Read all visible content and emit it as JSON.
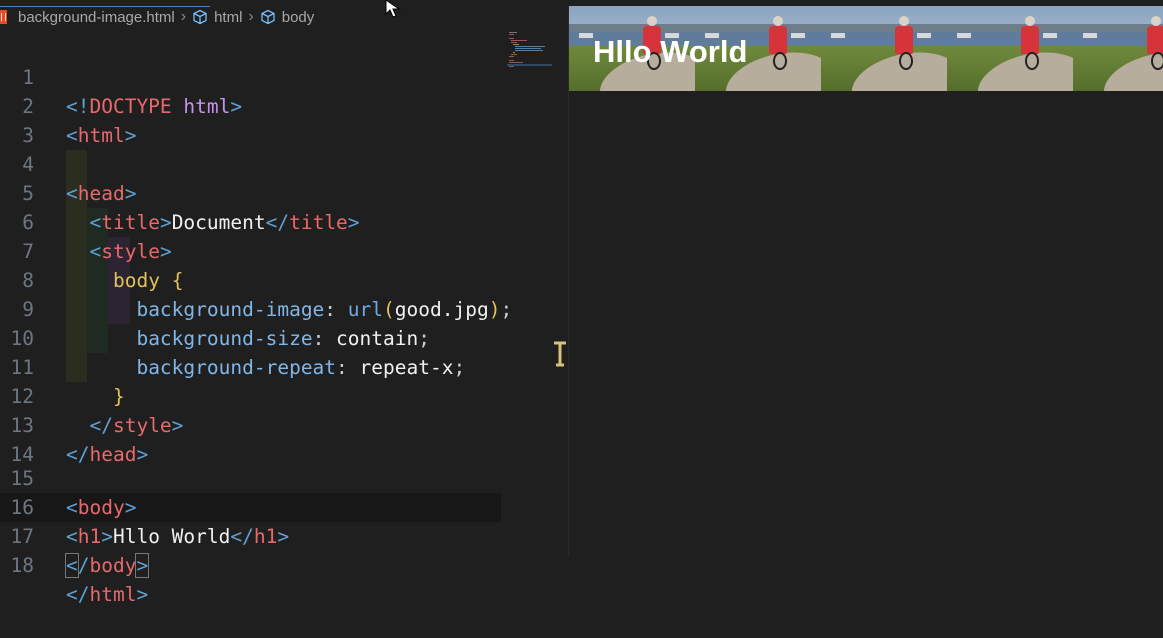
{
  "breadcrumb": {
    "file": "background-image.html",
    "item1": "html",
    "item2": "body"
  },
  "editor": {
    "lines": [
      {
        "n": "1"
      },
      {
        "n": "2"
      },
      {
        "n": "3"
      },
      {
        "n": "4"
      },
      {
        "n": "5"
      },
      {
        "n": "6"
      },
      {
        "n": "7"
      },
      {
        "n": "8"
      },
      {
        "n": "9"
      },
      {
        "n": "10"
      },
      {
        "n": "11"
      },
      {
        "n": "12"
      },
      {
        "n": "13"
      },
      {
        "n": "14"
      },
      {
        "n": "15"
      },
      {
        "n": "16"
      },
      {
        "n": "17"
      },
      {
        "n": "18"
      }
    ],
    "tokens": {
      "doctype_open": "<!",
      "doctype_kw": "DOCTYPE",
      "doctype_html": "html",
      "doctype_close": ">",
      "html": "html",
      "head": "head",
      "title": "title",
      "title_text": "Document",
      "style": "style",
      "selector": "body",
      "brace_open": "{",
      "brace_close": "}",
      "prop1": "background-image",
      "fn_url": "url",
      "url_arg": "good.jpg",
      "prop2": "background-size",
      "val2": "contain",
      "prop3": "background-repeat",
      "val3": "repeat-x",
      "body": "body",
      "h1": "h1",
      "h1_text": "Hllo World"
    }
  },
  "preview": {
    "heading": "Hllo World"
  },
  "colors": {
    "background": "#1f1f1f",
    "tag": "#e8696b",
    "bracket": "#5ea1d6",
    "property": "#80b6e8",
    "selector": "#e2c25b"
  }
}
